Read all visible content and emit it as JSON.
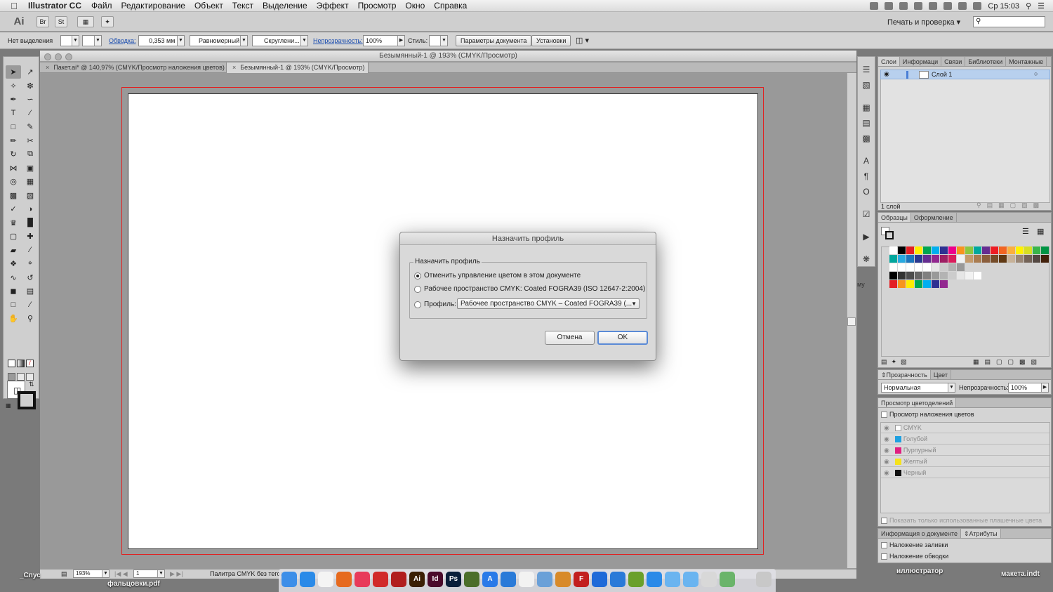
{
  "menubar": {
    "app": "Illustrator CC",
    "items": [
      "Файл",
      "Редактирование",
      "Объект",
      "Текст",
      "Выделение",
      "Эффект",
      "Просмотр",
      "Окно",
      "Справка"
    ],
    "clock": "Ср 15:03"
  },
  "appbar": {
    "logo": "Ai",
    "workspace": "Печать и проверка",
    "search_placeholder": ""
  },
  "control": {
    "no_selection": "Нет выделения",
    "stroke_link": "Обводка:",
    "stroke_value": "0,353 мм",
    "profile": "Равномерный",
    "brush": "Скруглени...",
    "opacity_link": "Непрозрачность:",
    "opacity_value": "100%",
    "style_label": "Стиль:",
    "doc_setup": "Параметры документа",
    "prefs": "Установки"
  },
  "document": {
    "title": "Безымянный-1 @ 193% (CMYK/Просмотр)",
    "tabs": [
      {
        "label": "Пакет.ai* @ 140,97% (CMYK/Просмотр наложения цветов)",
        "active": false
      },
      {
        "label": "Безымянный-1 @ 193% (CMYK/Просмотр)",
        "active": true
      }
    ],
    "zoom": "193%",
    "page": "1",
    "status_text": "Палитра CMYK без тегов"
  },
  "dialog": {
    "title": "Назначить профиль",
    "group_label": "Назначить профиль",
    "options": [
      {
        "label": "Отменить управление цветом в этом документе",
        "selected": true
      },
      {
        "label": "Рабочее пространство CMYK: Coated FOGRA39 (ISO 12647-2:2004)",
        "selected": false
      },
      {
        "label": "Профиль:",
        "selected": false
      }
    ],
    "profile_select": "Рабочее пространство CMYK – Coated FOGRA39 (...",
    "cancel": "Отмена",
    "ok": "OK"
  },
  "layers_panel": {
    "tabs": [
      "Слои",
      "Информаци",
      "Связи",
      "Библиотеки",
      "Монтажные"
    ],
    "layer_name": "Слой 1",
    "footer": "1 слой"
  },
  "swatches_panel": {
    "tabs": [
      "Образцы",
      "Оформление"
    ]
  },
  "transparency_panel": {
    "tabs": [
      "Прозрачность",
      "Цвет"
    ],
    "mode": "Нормальная",
    "opacity_label": "Непрозрачность:",
    "opacity_value": "100%"
  },
  "separations_panel": {
    "title": "Просмотр цветоделений",
    "overprint_preview": "Просмотр наложения цветов",
    "plates": [
      "CMYK",
      "Голубой",
      "Пурпурный",
      "Желтый",
      "Черный"
    ],
    "show_used": "Показать только использованные плашечные цвета"
  },
  "docinfo_panel": {
    "tabs": [
      "Информация о документе",
      "Атрибуты"
    ],
    "fill_overprint": "Наложение заливки",
    "stroke_overprint": "Наложение обводки"
  },
  "desktop": {
    "left_label": "_Спус",
    "left_file": "фальцовки.pdf",
    "right_file1": "иллюстратор",
    "right_file2": "макета.indt",
    "partial": "му"
  },
  "colors": {
    "bleed": "#e12020",
    "selection": "#b8d0ee",
    "default_button": "#5a8ad6"
  }
}
